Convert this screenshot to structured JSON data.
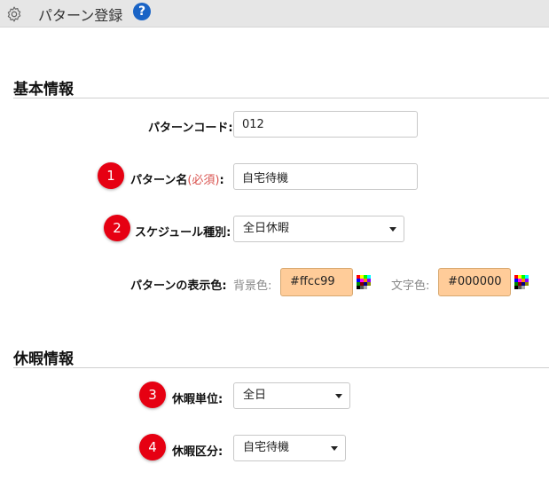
{
  "header": {
    "title": "パターン登録",
    "help_icon": "question-icon",
    "settings_icon": "gear-icon"
  },
  "basic_section": {
    "title": "基本情報",
    "pattern_code": {
      "label": "パターンコード:",
      "value": "012"
    },
    "pattern_name": {
      "badge": "1",
      "label": "パターン名",
      "required": "(必須)",
      "colon": ":",
      "value": "自宅待機"
    },
    "schedule_type": {
      "badge": "2",
      "label": "スケジュール種別:",
      "selected": "全日休暇"
    },
    "display_color": {
      "label": "パターンの表示色:",
      "bg_label": "背景色:",
      "bg_value": "#ffcc99",
      "text_label": "文字色:",
      "text_value": "#000000"
    }
  },
  "leave_section": {
    "title": "休暇情報",
    "leave_unit": {
      "badge": "3",
      "label": "休暇単位:",
      "selected": "全日"
    },
    "leave_category": {
      "badge": "4",
      "label": "休暇区分:",
      "selected": "自宅待機"
    }
  },
  "colors": {
    "accent_red": "#e60012",
    "swatch": "#ffcc99",
    "help_blue": "#1a64c6",
    "required_red": "#d9534f"
  }
}
